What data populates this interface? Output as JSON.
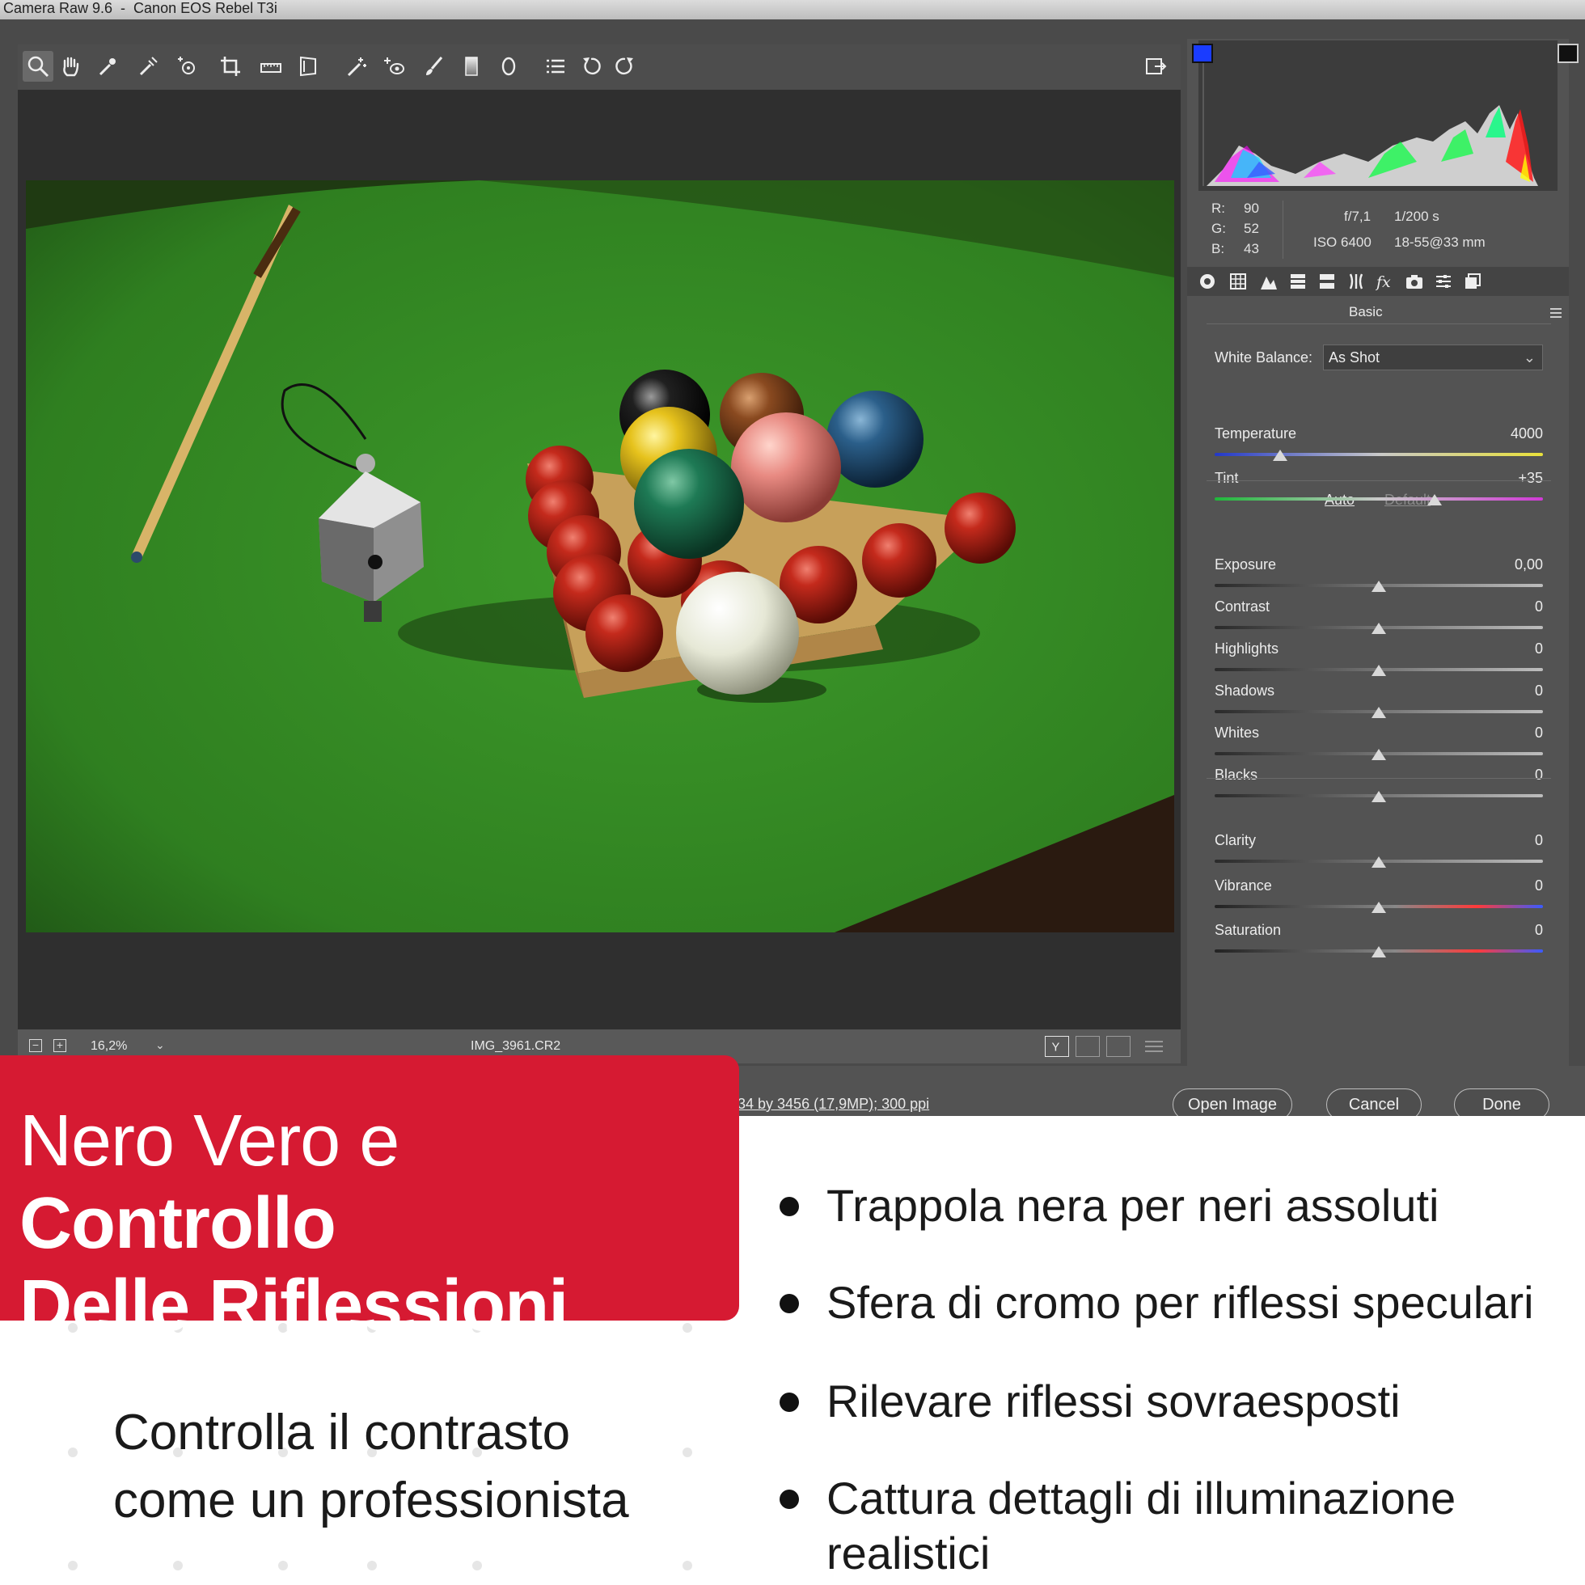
{
  "window": {
    "title": "Camera Raw 9.6  -  Canon EOS Rebel T3i"
  },
  "toolbar": {
    "tools": [
      "zoom-tool-icon",
      "hand-tool-icon",
      "white-balance-icon",
      "color-sampler-icon",
      "targeted-adjustment-icon",
      "crop-icon",
      "straighten-icon",
      "transform-icon",
      "spot-removal-icon",
      "red-eye-icon",
      "adjustment-brush-icon",
      "graduated-filter-icon",
      "radial-filter-icon",
      "preferences-icon",
      "rotate-ccw-icon",
      "rotate-cw-icon"
    ]
  },
  "status": {
    "zoom": "16,2%",
    "filename": "IMG_3961.CR2"
  },
  "image_info": "34 by 3456 (17,9MP); 300 ppi",
  "dialog_buttons": {
    "open": "Open Image",
    "cancel": "Cancel",
    "done": "Done"
  },
  "readout": {
    "r_label": "R:",
    "r": "90",
    "g_label": "G:",
    "g": "52",
    "b_label": "B:",
    "b": "43",
    "aperture": "f/7,1",
    "shutter": "1/200 s",
    "iso": "ISO 6400",
    "lens": "18-55@33 mm"
  },
  "panel": {
    "title": "Basic",
    "white_balance_label": "White Balance:",
    "white_balance_value": "As Shot",
    "auto": "Auto",
    "default": "Default",
    "sliders": [
      {
        "label": "Temperature",
        "value": "4000",
        "position": 0.2
      },
      {
        "label": "Tint",
        "value": "+35",
        "position": 0.67
      },
      {
        "label": "Exposure",
        "value": "0,00",
        "position": 0.5
      },
      {
        "label": "Contrast",
        "value": "0",
        "position": 0.5
      },
      {
        "label": "Highlights",
        "value": "0",
        "position": 0.5
      },
      {
        "label": "Shadows",
        "value": "0",
        "position": 0.5
      },
      {
        "label": "Whites",
        "value": "0",
        "position": 0.5
      },
      {
        "label": "Blacks",
        "value": "0",
        "position": 0.5
      },
      {
        "label": "Clarity",
        "value": "0",
        "position": 0.5
      },
      {
        "label": "Vibrance",
        "value": "0",
        "position": 0.5
      },
      {
        "label": "Saturation",
        "value": "0",
        "position": 0.5
      }
    ]
  },
  "promo": {
    "headline_light": "Nero Vero e ",
    "headline_bold_1": "Controllo",
    "headline_bold_2": "Delle Riflessioni",
    "tagline_1": "Controlla il contrasto",
    "tagline_2": "come un professionista",
    "bullets": [
      "Trappola nera per neri assoluti",
      "Sfera di cromo per riflessi speculari",
      "Rilevare riflessi sovraesposti",
      "Cattura dettagli di illuminazione",
      "realistici"
    ],
    "accent_color": "#d61a32"
  }
}
